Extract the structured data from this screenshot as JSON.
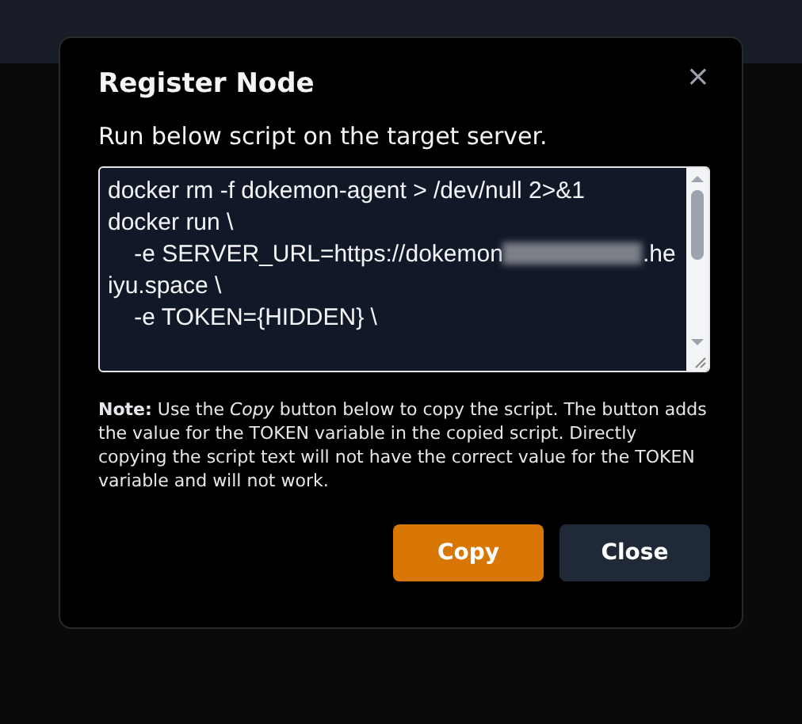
{
  "dialog": {
    "title": "Register Node",
    "close_icon": "×",
    "instruction": "Run below script on the target server.",
    "script": [
      {
        "kind": "text",
        "text": "docker rm -f dokemon-agent > /dev/null 2>&1\ndocker run \\\n    -e SERVER_URL=https://dokemon"
      },
      {
        "kind": "redacted"
      },
      {
        "kind": "text",
        "text": ".heiyu.space \\\n    -e TOKEN={HIDDEN} \\"
      }
    ],
    "note": "**Note:** Use the *Copy* button below to copy the script. The button adds the value for the TOKEN variable in the copied script. Directly copying the script text will not have the correct value for the TOKEN variable and will not work.",
    "buttons": [
      {
        "label": "Copy",
        "kind": "primary"
      },
      {
        "label": "Close",
        "kind": "secondary"
      }
    ]
  }
}
